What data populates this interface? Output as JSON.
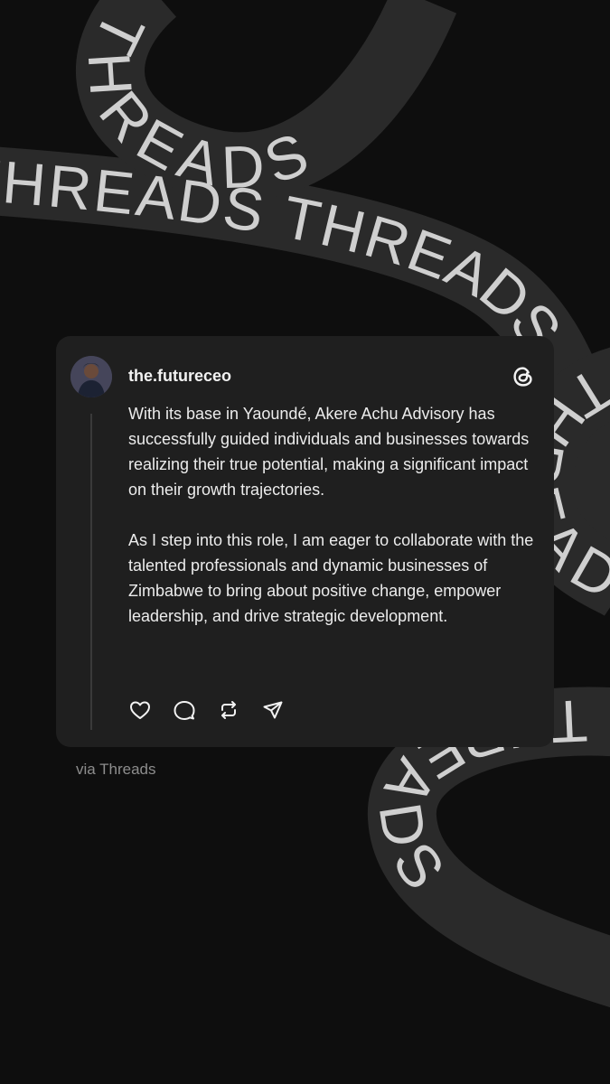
{
  "background": {
    "ribbon_word": "THREADS",
    "ribbon_color": "#2a2a2a",
    "ribbon_text_color": "#cfcfcf"
  },
  "post": {
    "username": "the.futureceo",
    "paragraphs": [
      "With its base in Yaoundé, Akere Achu Advisory has successfully guided individuals and businesses towards realizing their true potential, making a significant impact on their growth trajectories.",
      "As I step into this role, I am eager to collaborate with the talented professionals and dynamic businesses of Zimbabwe to bring about positive change, empower leadership, and drive strategic development."
    ],
    "actions": [
      "heart-icon",
      "comment-icon",
      "repost-icon",
      "share-icon"
    ]
  },
  "footer": {
    "via_text": "via Threads"
  },
  "colors": {
    "page_bg": "#0e0e0e",
    "card_bg": "#1f1f1f",
    "text": "#ececec",
    "muted": "#8d8d8d"
  }
}
